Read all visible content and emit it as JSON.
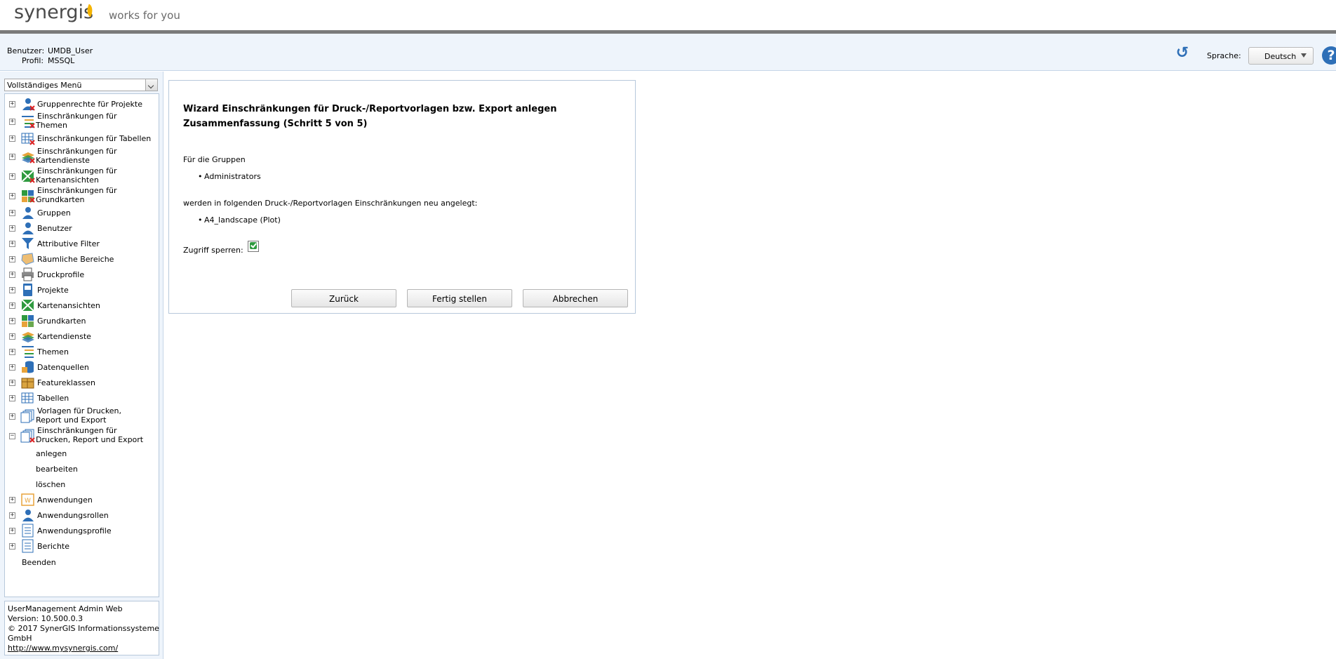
{
  "header": {
    "logo_text": "synergis",
    "tagline": "works for you"
  },
  "userinfo": {
    "user_label": "Benutzer:",
    "user_value": "UMDB_User",
    "profile_label": "Profil:",
    "profile_value": "MSSQL",
    "language_label": "Sprache:",
    "language_value": "Deutsch",
    "help_glyph": "?"
  },
  "sidebar": {
    "menu_select_value": "Vollständiges Menü",
    "items": [
      {
        "label": "Gruppenrechte für Projekte",
        "icon": "group-rights-icon",
        "expanded": false
      },
      {
        "label": "Einschränkungen für",
        "label2": "Themen",
        "icon": "theme-restriction-icon",
        "expanded": false
      },
      {
        "label": "Einschränkungen für Tabellen",
        "icon": "table-restriction-icon",
        "expanded": false
      },
      {
        "label": "Einschränkungen für",
        "label2": "Kartendienste",
        "icon": "mapservice-restriction-icon",
        "expanded": false
      },
      {
        "label": "Einschränkungen für",
        "label2": "Kartenansichten",
        "icon": "mapview-restriction-icon",
        "expanded": false
      },
      {
        "label": "Einschränkungen für",
        "label2": "Grundkarten",
        "icon": "basemap-restriction-icon",
        "expanded": false
      },
      {
        "label": "Gruppen",
        "icon": "groups-icon",
        "expanded": false
      },
      {
        "label": "Benutzer",
        "icon": "user-icon",
        "expanded": false
      },
      {
        "label": "Attributive Filter",
        "icon": "filter-icon",
        "expanded": false
      },
      {
        "label": "Räumliche Bereiche",
        "icon": "spatial-area-icon",
        "expanded": false
      },
      {
        "label": "Druckprofile",
        "icon": "printer-icon",
        "expanded": false
      },
      {
        "label": "Projekte",
        "icon": "project-icon",
        "expanded": false
      },
      {
        "label": "Kartenansichten",
        "icon": "mapview-icon",
        "expanded": false
      },
      {
        "label": "Grundkarten",
        "icon": "basemap-icon",
        "expanded": false
      },
      {
        "label": "Kartendienste",
        "icon": "mapservice-icon",
        "expanded": false
      },
      {
        "label": "Themen",
        "icon": "themes-icon",
        "expanded": false
      },
      {
        "label": "Datenquellen",
        "icon": "datasource-icon",
        "expanded": false
      },
      {
        "label": "Featureklassen",
        "icon": "featureclass-icon",
        "expanded": false
      },
      {
        "label": "Tabellen",
        "icon": "tables-icon",
        "expanded": false
      },
      {
        "label": "Vorlagen für Drucken,",
        "label2": "Report und Export",
        "icon": "print-template-icon",
        "expanded": false
      },
      {
        "label": "Einschränkungen für",
        "label2": "Drucken, Report und Export",
        "icon": "print-restriction-icon",
        "expanded": true
      }
    ],
    "subitems": [
      "anlegen",
      "bearbeiten",
      "löschen"
    ],
    "items_after": [
      {
        "label": "Anwendungen",
        "icon": "applications-icon",
        "expanded": false
      },
      {
        "label": "Anwendungsrollen",
        "icon": "application-roles-icon",
        "expanded": false
      },
      {
        "label": "Anwendungsprofile",
        "icon": "application-profiles-icon",
        "expanded": false
      },
      {
        "label": "Berichte",
        "icon": "reports-icon",
        "expanded": false
      }
    ],
    "exit_label": "Beenden",
    "footer": {
      "line1": "UserManagement Admin Web",
      "line2": "Version: 10.500.0.3",
      "line3": "© 2017 SynerGIS Informationssysteme",
      "line4": "GmbH",
      "link": "http://www.mysynergis.com/"
    }
  },
  "wizard": {
    "title_line1": "Wizard Einschränkungen für Druck-/Reportvorlagen bzw. Export anlegen",
    "title_line2": "Zusammenfassung (Schritt 5 von 5)",
    "groups_intro": "Für die Gruppen",
    "groups": [
      "Administrators"
    ],
    "templates_intro": "werden in folgenden Druck-/Reportvorlagen Einschränkungen neu angelegt:",
    "templates": [
      "A4_landscape (Plot)"
    ],
    "lock_label": "Zugriff sperren:",
    "lock_checked": true,
    "back_label": "Zurück",
    "finish_label": "Fertig stellen",
    "cancel_label": "Abbrechen"
  },
  "colors": {
    "accent_blue": "#2e6fb7",
    "header_rule": "#7a7a7a",
    "panel_bg": "#eef4fb",
    "logo_leaf": "#f5b400"
  }
}
